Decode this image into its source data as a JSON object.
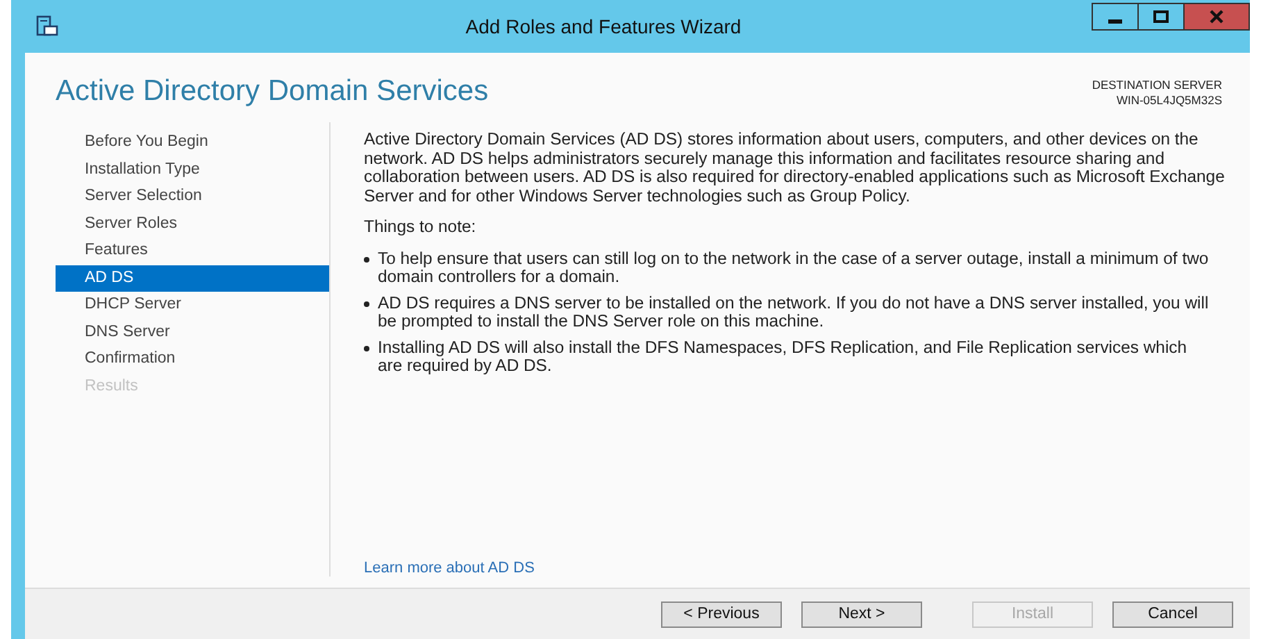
{
  "window": {
    "title": "Add Roles and Features Wizard"
  },
  "page_title": "Active Directory Domain Services",
  "destination": {
    "label": "DESTINATION SERVER",
    "server": "WIN-05L4JQ5M32S"
  },
  "steps": [
    {
      "label": "Before You Begin",
      "selected": false,
      "disabled": false
    },
    {
      "label": "Installation Type",
      "selected": false,
      "disabled": false
    },
    {
      "label": "Server Selection",
      "selected": false,
      "disabled": false
    },
    {
      "label": "Server Roles",
      "selected": false,
      "disabled": false
    },
    {
      "label": "Features",
      "selected": false,
      "disabled": false
    },
    {
      "label": "AD DS",
      "selected": true,
      "disabled": false
    },
    {
      "label": "DHCP Server",
      "selected": false,
      "disabled": false
    },
    {
      "label": "DNS Server",
      "selected": false,
      "disabled": false
    },
    {
      "label": "Confirmation",
      "selected": false,
      "disabled": false
    },
    {
      "label": "Results",
      "selected": false,
      "disabled": true
    }
  ],
  "intro": "Active Directory Domain Services (AD DS) stores information about users, computers, and other devices on the network.  AD DS helps administrators securely manage this information and facilitates resource sharing and collaboration between users.  AD DS is also required for directory-enabled applications such as Microsoft Exchange Server and for other Windows Server technologies such as Group Policy.",
  "notes_heading": "Things to note:",
  "notes": [
    "To help ensure that users can still log on to the network in the case of a server outage, install a minimum of two domain controllers for a domain.",
    "AD DS requires a DNS server to be installed on the network.  If you do not have a DNS server installed, you will be prompted to install the DNS Server role on this machine.",
    "Installing AD DS will also install the DFS Namespaces, DFS Replication, and File Replication services which are required by AD DS."
  ],
  "learn_more_link": "Learn more about AD DS",
  "buttons": [
    {
      "label": "< Previous",
      "disabled": false
    },
    {
      "label": "Next >",
      "disabled": false
    },
    {
      "label": "Install",
      "disabled": true
    },
    {
      "label": "Cancel",
      "disabled": false
    }
  ]
}
